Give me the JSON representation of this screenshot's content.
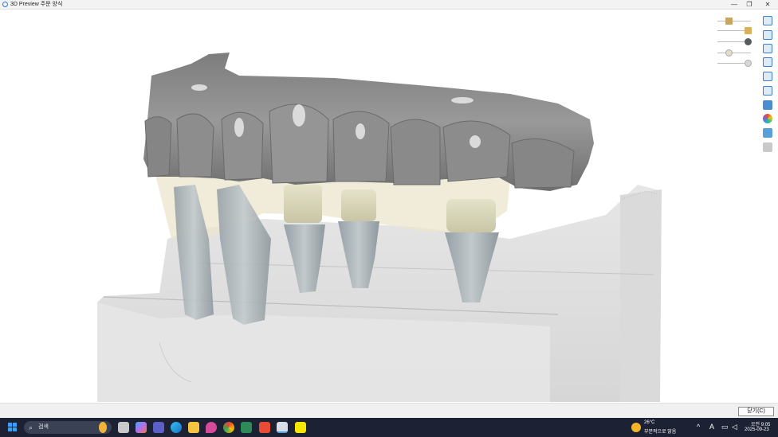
{
  "window": {
    "title": "3D Preview 주문 양식",
    "minimize_glyph": "—",
    "maximize_glyph": "❐",
    "close_glyph": "✕"
  },
  "viewer": {
    "model": "dental-arch-with-implant-abutments",
    "toolbar_icons": [
      "view-front-icon",
      "view-back-icon",
      "view-left-icon",
      "view-right-icon",
      "view-top-icon",
      "view-bottom-icon",
      "layers-icon",
      "color-icon",
      "visibility-icon",
      "screenshot-icon"
    ],
    "sliders": [
      {
        "name": "gingiva-transparency",
        "value": 0.3,
        "color": "#c7a660"
      },
      {
        "name": "crown-transparency",
        "value": 0.95,
        "color": "#d9b15a"
      },
      {
        "name": "abutment-transparency",
        "value": 0.95,
        "color": "#555b5e"
      },
      {
        "name": "scan-transparency",
        "value": 0.2,
        "color": "#e0dcc8"
      },
      {
        "name": "antagonist-transparency",
        "value": 0.95,
        "color": "#d8d8d8"
      }
    ]
  },
  "bottom_bar": {
    "close_label": "닫기(C)"
  },
  "taskbar": {
    "search_placeholder": "검색",
    "weather_temp": "26°C",
    "weather_desc": "부분적으로 맑음",
    "time": "오전 9:05",
    "date": "2025-09-23",
    "ime_label": "A",
    "tray_chevron": "^"
  },
  "colors": {
    "accent": "#2b7bd6",
    "taskbar_bg": "#1c2233",
    "tooth_gray": "#8c8c8c"
  }
}
